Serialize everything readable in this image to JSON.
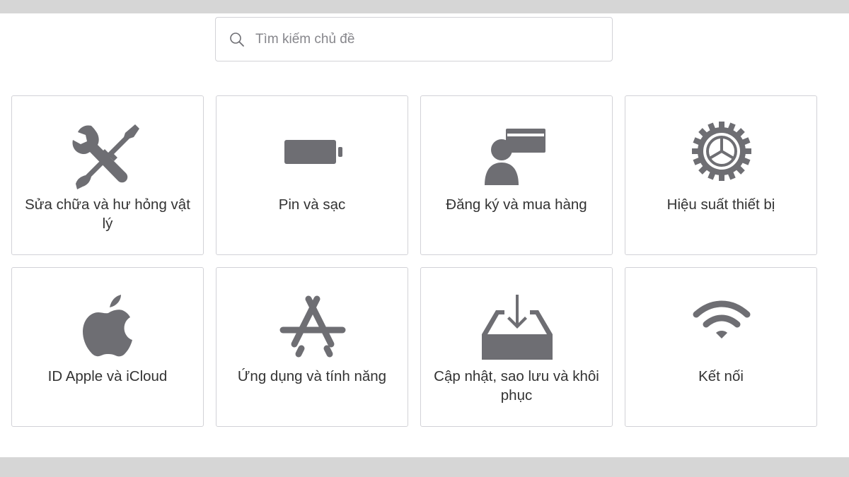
{
  "search": {
    "placeholder": "Tìm kiếm chủ đề",
    "value": ""
  },
  "topics": [
    {
      "label": "Sửa chữa và hư hỏng vật lý",
      "icon": "wrench-screwdriver-icon"
    },
    {
      "label": "Pin và sạc",
      "icon": "battery-icon"
    },
    {
      "label": "Đăng ký và mua hàng",
      "icon": "person-card-icon"
    },
    {
      "label": "Hiệu suất thiết bị",
      "icon": "gear-icon"
    },
    {
      "label": "ID Apple và iCloud",
      "icon": "apple-icon"
    },
    {
      "label": "Ứng dụng và tính năng",
      "icon": "app-store-icon"
    },
    {
      "label": "Cập nhật, sao lưu và khôi phục",
      "icon": "download-tray-icon"
    },
    {
      "label": "Kết nối",
      "icon": "wifi-icon"
    }
  ],
  "colors": {
    "icon": "#6e6e73",
    "text": "#333333",
    "border": "#d2d2d7",
    "band": "#d6d6d6"
  }
}
